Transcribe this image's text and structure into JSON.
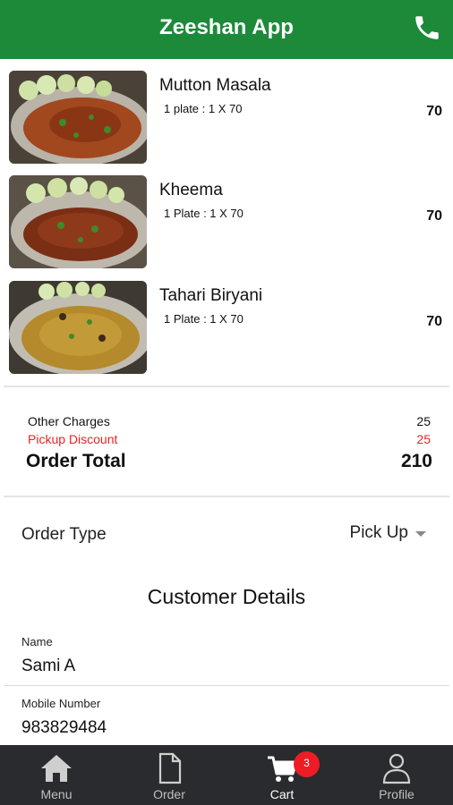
{
  "app": {
    "title": "Zeeshan App",
    "header_icon": "phone-icon"
  },
  "cart_items": [
    {
      "name": "Mutton Masala",
      "qty": "1 plate : 1 X 70",
      "price": "70"
    },
    {
      "name": "Kheema",
      "qty": "1 Plate : 1 X 70",
      "price": "70"
    },
    {
      "name": "Tahari Biryani",
      "qty": "1 Plate : 1 X 70",
      "price": "70"
    }
  ],
  "summary": {
    "other_charges_label": "Other Charges",
    "other_charges_value": "25",
    "pickup_discount_label": "Pickup Discount",
    "pickup_discount_value": "25",
    "order_total_label": "Order Total",
    "order_total_value": "210"
  },
  "order_type": {
    "label": "Order Type",
    "selected": "Pick Up"
  },
  "customer": {
    "title": "Customer Details",
    "name_label": "Name",
    "name_value": "Sami A",
    "mobile_label": "Mobile Number",
    "mobile_value": "983829484"
  },
  "tabs": [
    {
      "label": "Menu",
      "icon": "home-icon"
    },
    {
      "label": "Order",
      "icon": "document-icon"
    },
    {
      "label": "Cart",
      "icon": "cart-icon",
      "badge": "3"
    },
    {
      "label": "Profile",
      "icon": "person-icon"
    }
  ],
  "colors": {
    "header": "#1d8a3a",
    "discount": "#ee2222",
    "tabbar": "#2a2b2e",
    "badge": "#ee1c24"
  }
}
